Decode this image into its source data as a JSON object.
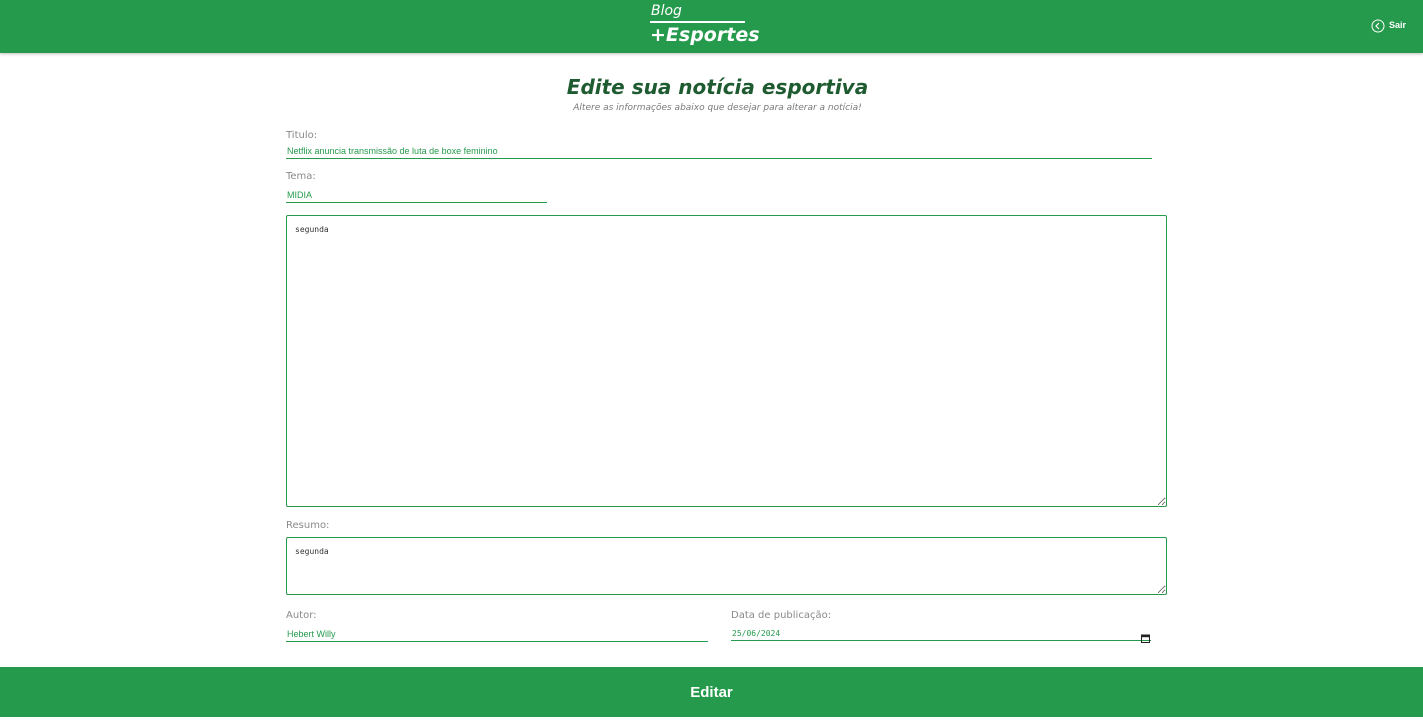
{
  "header": {
    "logo_line1": "Blog",
    "logo_line2": "+Esportes",
    "logout_label": "Sair",
    "logout_icon": "arrow-left-circle-icon",
    "background_color": "#259a4c"
  },
  "page": {
    "title": "Edite sua notícia esportiva",
    "subtitle": "Altere as informações abaixo que desejar para alterar a notícia!"
  },
  "form": {
    "title_label": "Titulo:",
    "title_value": "Netflix anuncia transmissão de luta de boxe feminino",
    "theme_label": "Tema:",
    "theme_value": "MIDIA",
    "content_value": "segunda",
    "summary_label": "Resumo:",
    "summary_value": "segunda",
    "author_label": "Autor:",
    "author_value": "Hebert Willy",
    "date_label": "Data de publicação:",
    "date_value": "25/06/2024",
    "date_icon": "calendar-icon",
    "submit_label": "Editar",
    "accent_color": "#259a4c"
  }
}
